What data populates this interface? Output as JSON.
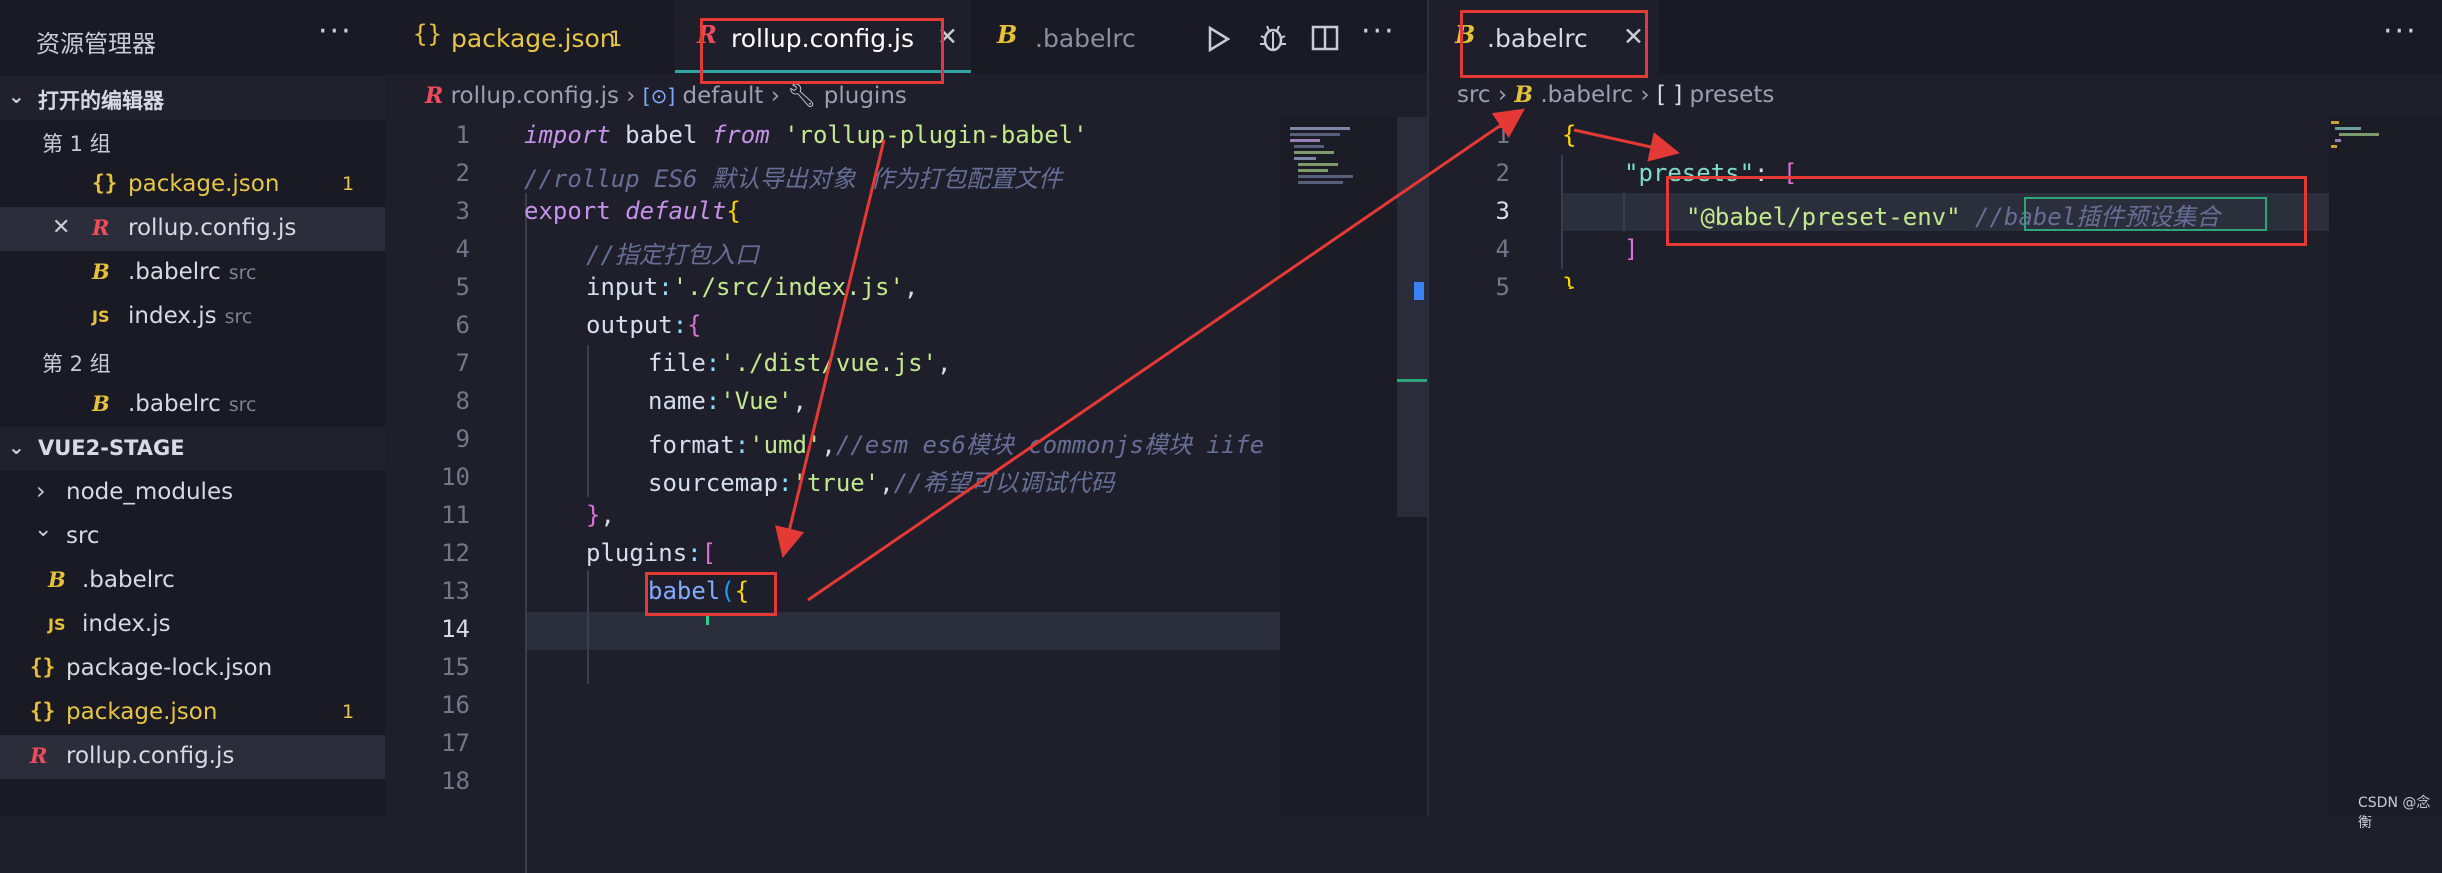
{
  "sidebar": {
    "title": "资源管理器",
    "more": "···",
    "open_editors": {
      "header": "打开的编辑器",
      "groups": [
        {
          "label": "第 1 组",
          "items": [
            {
              "icon": "json-icon",
              "icon_text": "{}",
              "name": "package.json",
              "badge": "1",
              "modified": true
            },
            {
              "icon": "rollup-icon",
              "icon_text": "R",
              "name": "rollup.config.js",
              "close": "✕"
            },
            {
              "icon": "babel-icon",
              "icon_text": "B",
              "name": ".babelrc",
              "desc": "src"
            },
            {
              "icon": "js-icon",
              "icon_text": "JS",
              "name": "index.js",
              "desc": "src"
            }
          ]
        },
        {
          "label": "第 2 组",
          "items": [
            {
              "icon": "babel-icon",
              "icon_text": "B",
              "name": ".babelrc",
              "desc": "src"
            }
          ]
        }
      ]
    },
    "workspace": {
      "header": "VUE2-STAGE",
      "items": [
        {
          "type": "folder",
          "name": "node_modules",
          "chevron": "›"
        },
        {
          "type": "folder",
          "name": "src",
          "chevron": "⌄"
        },
        {
          "icon_text": "B",
          "name": ".babelrc"
        },
        {
          "icon_text": "JS",
          "name": "index.js"
        },
        {
          "icon_text": "{}",
          "name": "package-lock.json"
        },
        {
          "icon_text": "{}",
          "name": "package.json",
          "badge": "1"
        },
        {
          "icon_text": "R",
          "name": "rollup.config.js"
        }
      ]
    }
  },
  "left_editor": {
    "tabs": [
      {
        "icon_text": "{}",
        "label": "package.json",
        "badge": "1"
      },
      {
        "icon_text": "R",
        "label": "rollup.config.js",
        "close": "✕",
        "active": true
      },
      {
        "icon_text": "B",
        "label": ".babelrc"
      }
    ],
    "breadcrumb": [
      "rollup.config.js",
      "default",
      "plugins"
    ],
    "breadcrumb_sep": "›",
    "line_numbers": [
      "1",
      "2",
      "3",
      "4",
      "5",
      "6",
      "7",
      "8",
      "9",
      "10",
      "11",
      "12",
      "13",
      "14",
      "15",
      "16",
      "17",
      "18"
    ],
    "current_line": "14"
  },
  "right_editor": {
    "tab": {
      "icon_text": "B",
      "label": ".babelrc",
      "close": "✕"
    },
    "breadcrumb": [
      "src",
      ".babelrc",
      "presets"
    ],
    "breadcrumb_sep": "›",
    "line_numbers": [
      "1",
      "2",
      "3",
      "4",
      "5"
    ],
    "current_line": "3"
  },
  "watermark": "CSDN @念衡",
  "colors": {
    "accent_red": "#e53935",
    "json_yellow": "#e6c13b",
    "rollup_red": "#ef4b5b"
  }
}
